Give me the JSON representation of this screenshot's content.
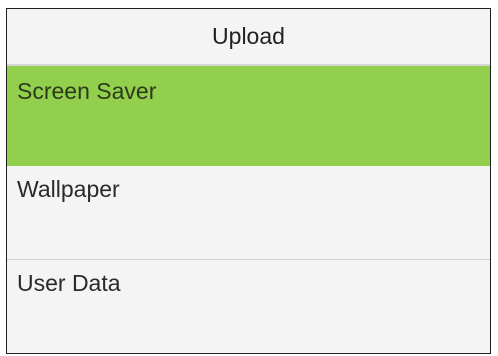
{
  "header": {
    "title": "Upload"
  },
  "menu": {
    "items": [
      {
        "label": "Screen Saver",
        "selected": true
      },
      {
        "label": "Wallpaper",
        "selected": false
      },
      {
        "label": "User Data",
        "selected": false
      }
    ]
  },
  "colors": {
    "selected_background": "#92cf4d",
    "background": "#f4f4f4",
    "border": "#1f1f1f"
  }
}
